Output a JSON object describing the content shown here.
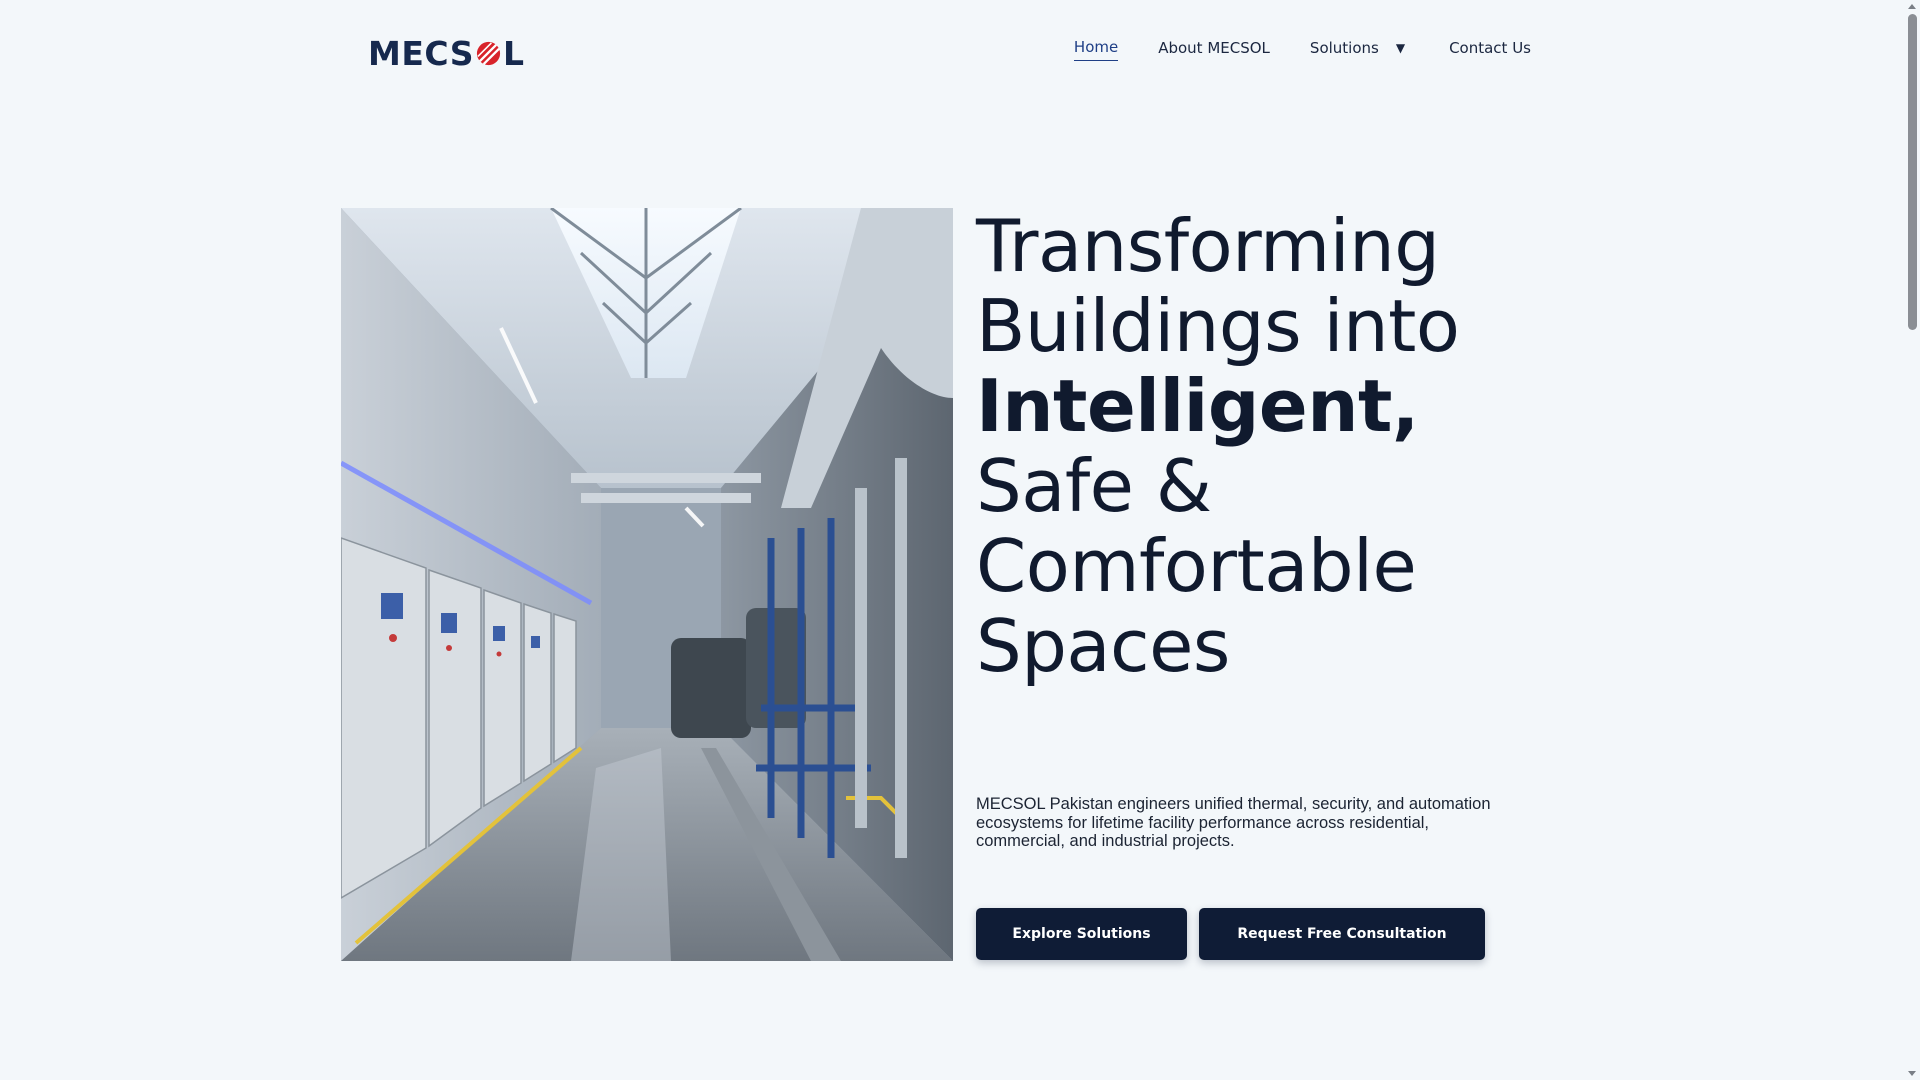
{
  "brand": {
    "logo_text_left": "MECS",
    "logo_text_right": "L",
    "colors": {
      "navy": "#16294e",
      "red": "#d8232a"
    }
  },
  "nav": {
    "items": [
      {
        "label": "Home",
        "active": true
      },
      {
        "label": "About MECSOL",
        "active": false
      },
      {
        "label": "Solutions",
        "active": false,
        "has_dropdown": true
      },
      {
        "label": "Contact Us",
        "active": false
      }
    ],
    "dropdown_icon": "chevron-down-icon"
  },
  "hero": {
    "headline": {
      "line1": "Transforming",
      "line2": "Buildings into",
      "line3_strong": "Intelligent,",
      "line4": "Safe &",
      "line5": "Comfortable",
      "line6": "Spaces"
    },
    "intro": "MECSOL Pakistan engineers unified thermal, security, and automation ecosystems for lifetime facility performance across residential, commercial, and industrial projects.",
    "buttons": {
      "primary": "Explore Solutions",
      "secondary": "Request Free Consultation"
    },
    "image": "mechanical-plant-room-photo"
  },
  "colors": {
    "background": "#f3f7fa",
    "button": "#0f1c36",
    "text": "#101a2e",
    "active_link": "#1f3f86"
  }
}
